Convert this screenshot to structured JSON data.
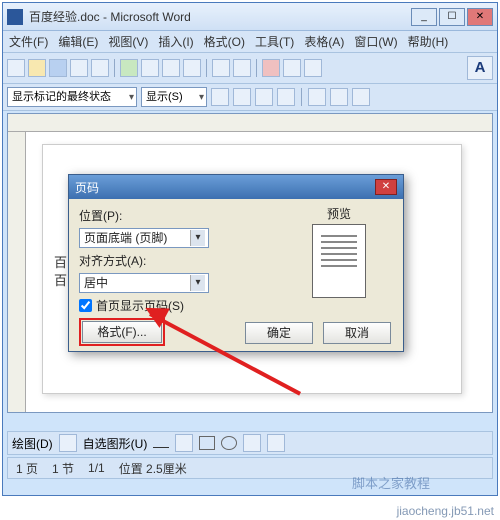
{
  "titlebar": {
    "doc_title": "百度经验.doc - Microsoft Word"
  },
  "window_controls": {
    "min": "_",
    "max": "☐",
    "close": "✕"
  },
  "menubar": {
    "file": "文件(F)",
    "edit": "编辑(E)",
    "view": "视图(V)",
    "insert": "插入(I)",
    "format": "格式(O)",
    "tools": "工具(T)",
    "table": "表格(A)",
    "window": "窗口(W)",
    "help": "帮助(H)"
  },
  "review_bar": {
    "state_label": "显示标记的最终状态",
    "show_label": "显示(S)"
  },
  "font_bar": {
    "style_A": "A"
  },
  "page_text": {
    "line1": "百",
    "line2": "百"
  },
  "dialog": {
    "title": "页码",
    "position_label": "位置(P):",
    "position_value": "页面底端 (页脚)",
    "align_label": "对齐方式(A):",
    "align_value": "居中",
    "firstpage_label": "首页显示页码(S)",
    "firstpage_checked": true,
    "format_btn": "格式(F)...",
    "preview_label": "预览",
    "ok": "确定",
    "cancel": "取消"
  },
  "drawbar": {
    "label": "绘图(D)",
    "autoshape": "自选图形(U)"
  },
  "statusbar": {
    "page": "1 页",
    "section": "1 节",
    "pages": "1/1",
    "position": "位置 2.5厘米"
  },
  "watermark": {
    "site": "jiaocheng.jb51.net",
    "brand": "脚本之家教程"
  }
}
